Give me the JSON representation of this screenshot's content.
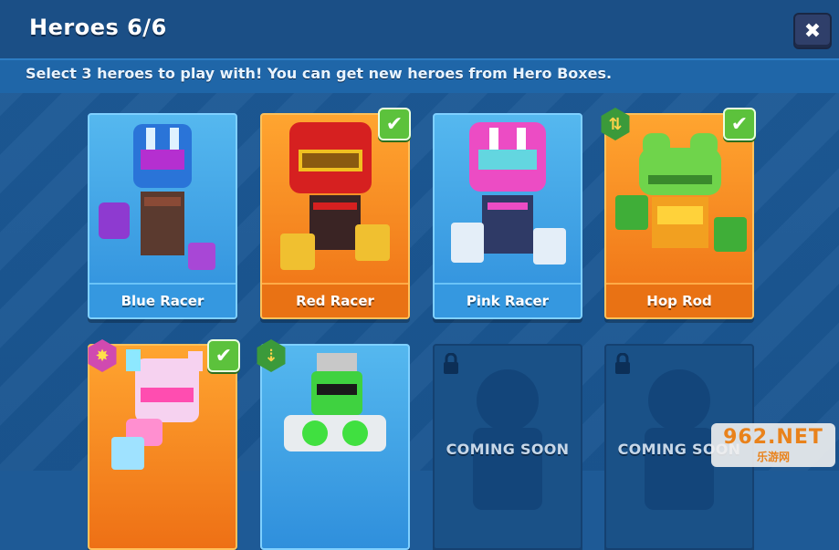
{
  "header": {
    "title": "Heroes 6/6",
    "close_label": "✖"
  },
  "subtitle": "Select 3 heroes to play with! You can get new heroes from Hero Boxes.",
  "heroes": [
    {
      "name": "Blue Racer",
      "theme": "blue",
      "selected": false
    },
    {
      "name": "Red Racer",
      "theme": "orange",
      "selected": true
    },
    {
      "name": "Pink Racer",
      "theme": "blue",
      "selected": false
    },
    {
      "name": "Hop Rod",
      "theme": "orange",
      "selected": true,
      "badge": "upgrade-icon"
    },
    {
      "name": "",
      "theme": "orange",
      "selected": true,
      "badge": "sparkle-icon"
    },
    {
      "name": "",
      "theme": "blue",
      "selected": false,
      "badge": "downgrade-icon"
    }
  ],
  "locked": [
    {
      "label": "COMING SOON"
    },
    {
      "label": "COMING SOON"
    }
  ],
  "check_glyph": "✔",
  "watermark": {
    "main": "962.NET",
    "sub": "乐游网"
  },
  "colors": {
    "background": "#1e5a96",
    "card_blue": "#3598e0",
    "card_orange": "#e97214",
    "check_green": "#5cc23c"
  }
}
